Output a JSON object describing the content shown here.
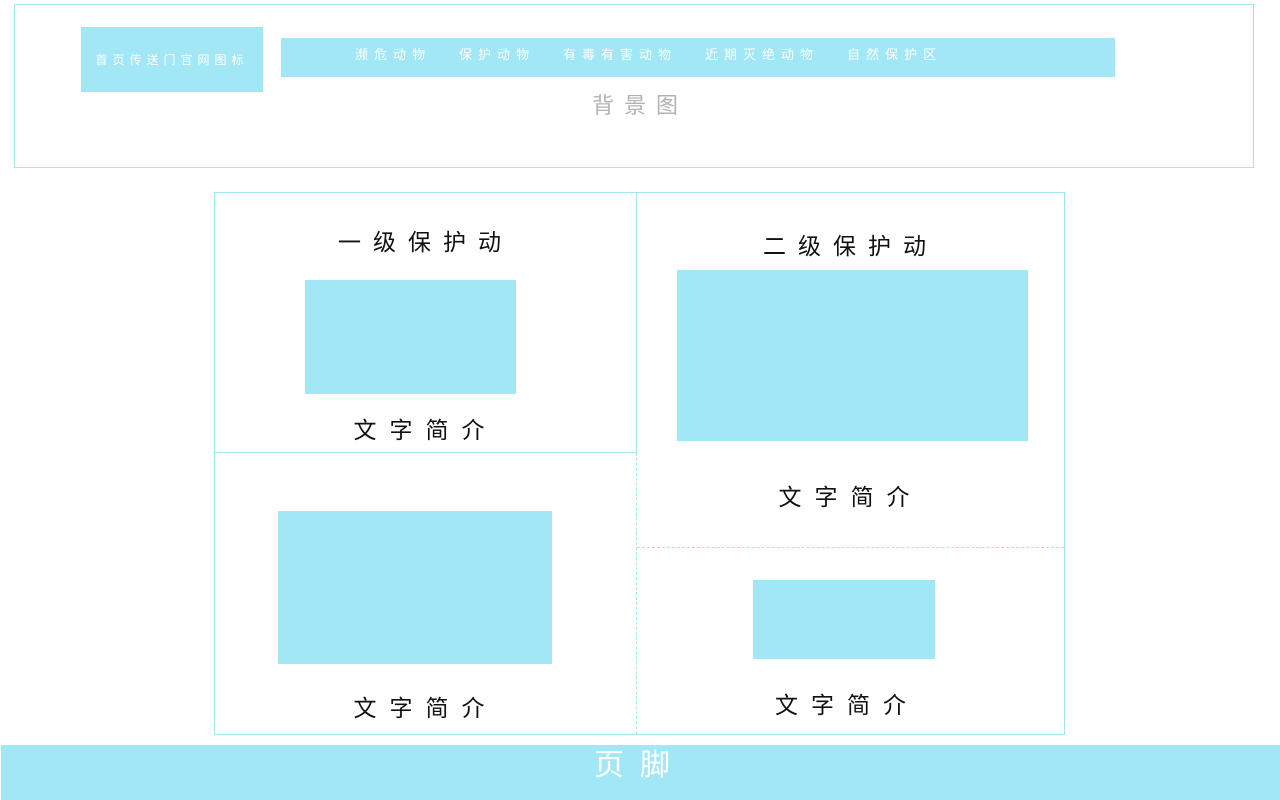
{
  "header": {
    "logo_label": "首页传送门官网图标",
    "nav": [
      {
        "label": "濒危动物"
      },
      {
        "label": "保护动物"
      },
      {
        "label": "有毒有害动物"
      },
      {
        "label": "近期灭绝动物"
      },
      {
        "label": "自然保护区"
      }
    ],
    "background_label": "背景图"
  },
  "sections": {
    "first_level": {
      "title": "一级保护动",
      "text": "文字简介"
    },
    "second_level": {
      "title": "二级保护动",
      "text": "文字简介"
    },
    "bottom_left": {
      "text": "文字简介"
    },
    "bottom_right": {
      "text": "文字简介"
    }
  },
  "footer": {
    "label": "页脚"
  },
  "colors": {
    "accent": "#a1e7f5",
    "border": "#a6e4f1"
  }
}
